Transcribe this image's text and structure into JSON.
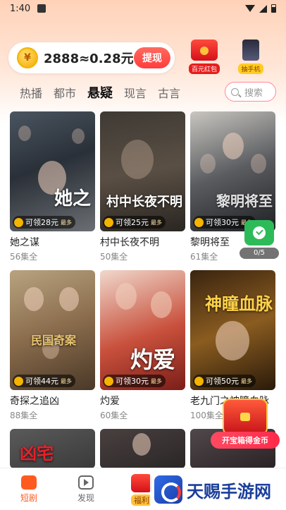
{
  "status_bar": {
    "time": "1:40"
  },
  "header": {
    "coin_icon_char": "¥",
    "coin_text": "2888≈0.28元",
    "withdraw_label": "提现",
    "promos": [
      {
        "label": "百元红包",
        "icon": "red-packet-icon"
      },
      {
        "label": "抽手机",
        "icon": "phone-prize-icon"
      }
    ]
  },
  "tabs": [
    {
      "label": "热播",
      "active": false
    },
    {
      "label": "都市",
      "active": false
    },
    {
      "label": "悬疑",
      "active": true
    },
    {
      "label": "现言",
      "active": false
    },
    {
      "label": "古言",
      "active": false
    }
  ],
  "search": {
    "placeholder": "搜索"
  },
  "dramas": [
    {
      "title": "她之谋",
      "episodes": "56集全",
      "reward": "可领28元",
      "max": "最多",
      "poster_title": "她之"
    },
    {
      "title": "村中长夜不明",
      "episodes": "50集全",
      "reward": "可领25元",
      "max": "最多",
      "poster_title": "村中长夜不明"
    },
    {
      "title": "黎明将至",
      "episodes": "61集全",
      "reward": "可领30元",
      "max": "最多",
      "poster_title": "黎明将至"
    },
    {
      "title": "奇探之追凶",
      "episodes": "88集全",
      "reward": "可领44元",
      "max": "最多",
      "poster_title": "民国奇案"
    },
    {
      "title": "灼爱",
      "episodes": "60集全",
      "reward": "可领30元",
      "max": "最多",
      "poster_title": "灼爱"
    },
    {
      "title": "老九门之神瞳血脉",
      "episodes": "100集全",
      "reward": "可领50元",
      "max": "最多",
      "poster_title": "神瞳血脉"
    },
    {
      "title": "",
      "episodes": "",
      "reward": "",
      "max": "",
      "poster_title": "凶宅"
    },
    {
      "title": "",
      "episodes": "",
      "reward": "",
      "max": "",
      "poster_title": ""
    },
    {
      "title": "",
      "episodes": "",
      "reward": "",
      "max": "",
      "poster_title": ""
    }
  ],
  "task_widget": {
    "progress": "0/5"
  },
  "treasure": {
    "label": "开宝箱得金币"
  },
  "bottom_nav": [
    {
      "label": "短剧",
      "icon": "short-drama-icon",
      "active": true
    },
    {
      "label": "发现",
      "icon": "discover-icon",
      "active": false
    },
    {
      "label": "福利",
      "icon": "welfare-icon",
      "active": false
    }
  ],
  "watermark": {
    "text": "天赐手游网"
  }
}
